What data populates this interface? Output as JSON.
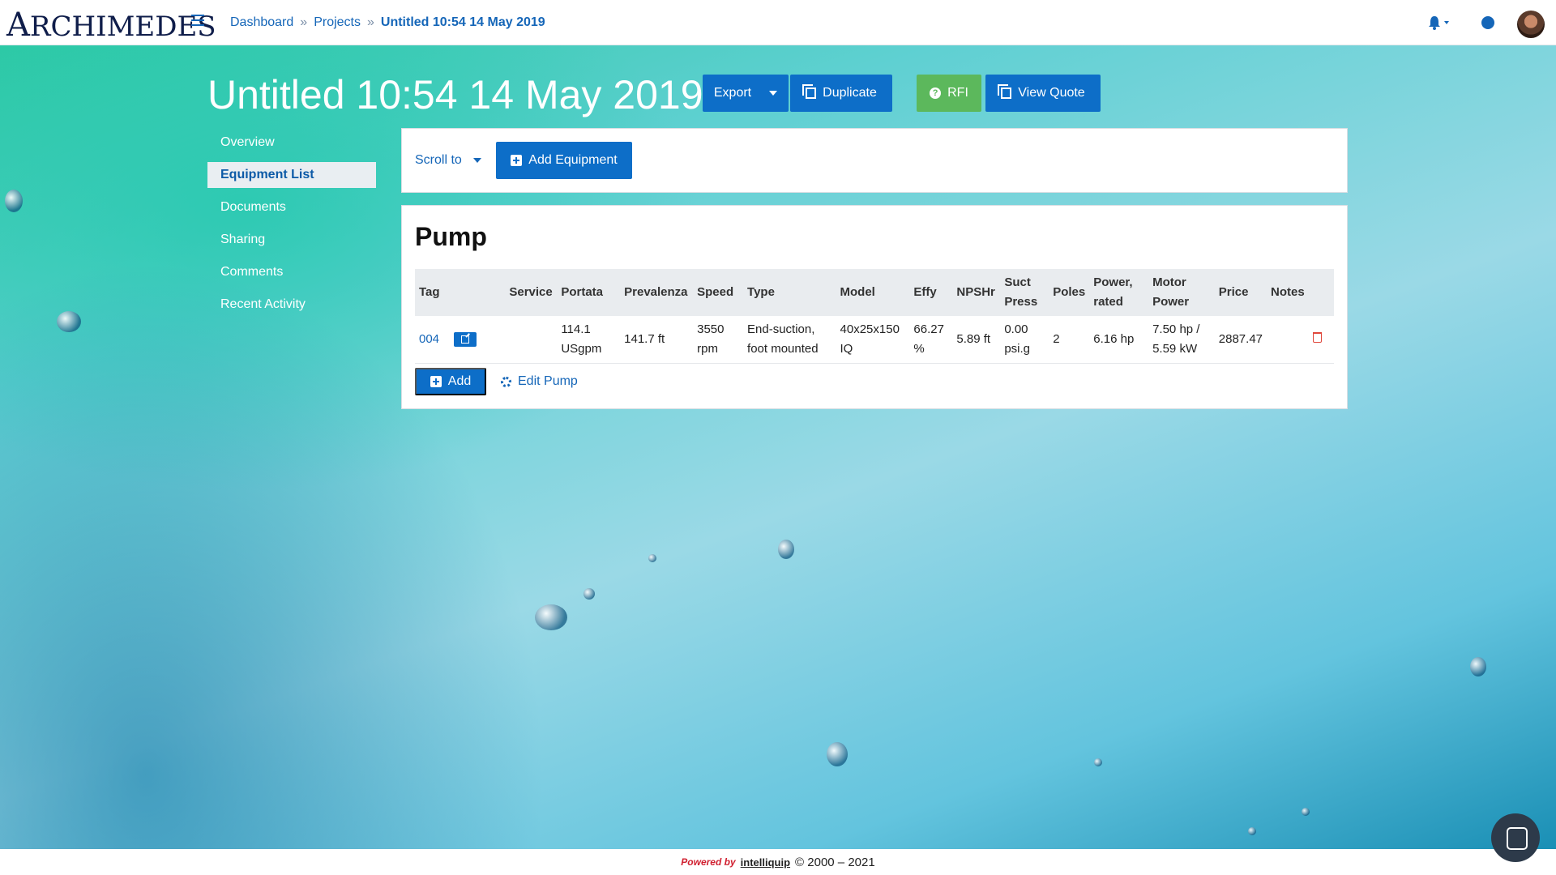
{
  "app": {
    "logo_text": "RCHIMEDES",
    "logo_initial": "A"
  },
  "breadcrumb": {
    "items": [
      "Dashboard",
      "Projects"
    ],
    "separator": "»",
    "current": "Untitled 10:54 14 May 2019"
  },
  "header_icons": [
    "bell-icon",
    "globe-icon",
    "avatar"
  ],
  "page": {
    "title": "Untitled 10:54 14 May 2019"
  },
  "actions": {
    "export": "Export",
    "duplicate": "Duplicate",
    "rfi": "RFI",
    "view_quote": "View Quote"
  },
  "sidenav": {
    "items": [
      "Overview",
      "Equipment List",
      "Documents",
      "Sharing",
      "Comments",
      "Recent Activity"
    ],
    "active": "Equipment List"
  },
  "toolbar": {
    "scroll_to": "Scroll to",
    "add_equipment": "Add Equipment"
  },
  "pump": {
    "title": "Pump",
    "columns": [
      "Tag",
      "Service",
      "Portata",
      "Prevalenza",
      "Speed",
      "Type",
      "Model",
      "Effy",
      "NPSHr",
      "Suct Press",
      "Poles",
      "Power, rated",
      "Motor Power",
      "Price",
      "Notes",
      ""
    ],
    "rows": [
      {
        "tag": "004",
        "service": "",
        "portata": "114.1 USgpm",
        "prevalenza": "141.7 ft",
        "speed": "3550 rpm",
        "type": "End-suction, foot mounted",
        "model": "40x25x150 IQ",
        "effy": "66.27 %",
        "npshr": "5.89 ft",
        "suct_press": "0.00 psi.g",
        "poles": "2",
        "power_rated": "6.16 hp",
        "motor_power": "7.50 hp / 5.59 kW",
        "price": "2887.47",
        "notes": ""
      }
    ],
    "add_label": "Add",
    "edit_label": "Edit Pump"
  },
  "footer": {
    "powered_by": "Powered by",
    "brand": "intelliquip",
    "copyright": "© 2000 – 2021"
  },
  "colors": {
    "primary": "#0d6ec8",
    "success": "#5cb85c",
    "danger": "#e0473b",
    "link": "#1566b8"
  }
}
